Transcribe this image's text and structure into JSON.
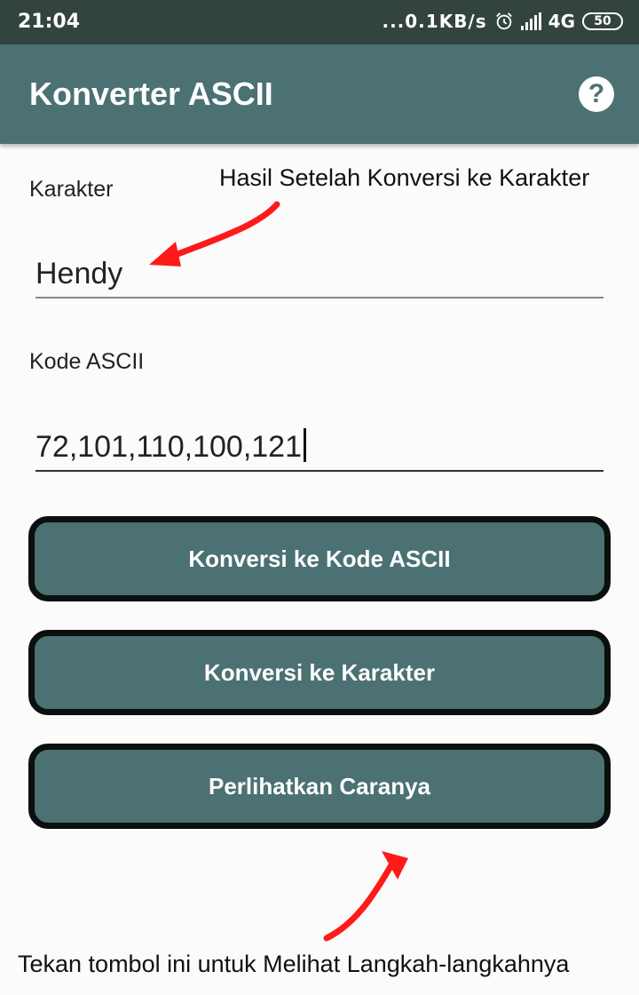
{
  "status_bar": {
    "time": "21:04",
    "network_speed": "...0.1KB/s",
    "network_type": "4G",
    "battery": "50",
    "icons": [
      "alarm-icon",
      "signal-icon",
      "battery-icon"
    ]
  },
  "app_bar": {
    "title": "Konverter ASCII",
    "help_icon": "?"
  },
  "form": {
    "karakter_label": "Karakter",
    "karakter_value": "Hendy",
    "ascii_label": "Kode ASCII",
    "ascii_value": "72,101,110,100,121"
  },
  "buttons": {
    "to_ascii": "Konversi ke Kode ASCII",
    "to_char": "Konversi ke Karakter",
    "show_steps": "Perlihatkan Caranya"
  },
  "annotations": {
    "top": "Hasil Setelah Konversi ke Karakter",
    "bottom": "Tekan tombol ini untuk Melihat Langkah-langkahnya"
  },
  "colors": {
    "status_bar": "#334440",
    "app_bar": "#4b7173",
    "button_fill": "#4b7173",
    "button_border": "#0b0f0e",
    "arrow": "#ff1a1a"
  }
}
